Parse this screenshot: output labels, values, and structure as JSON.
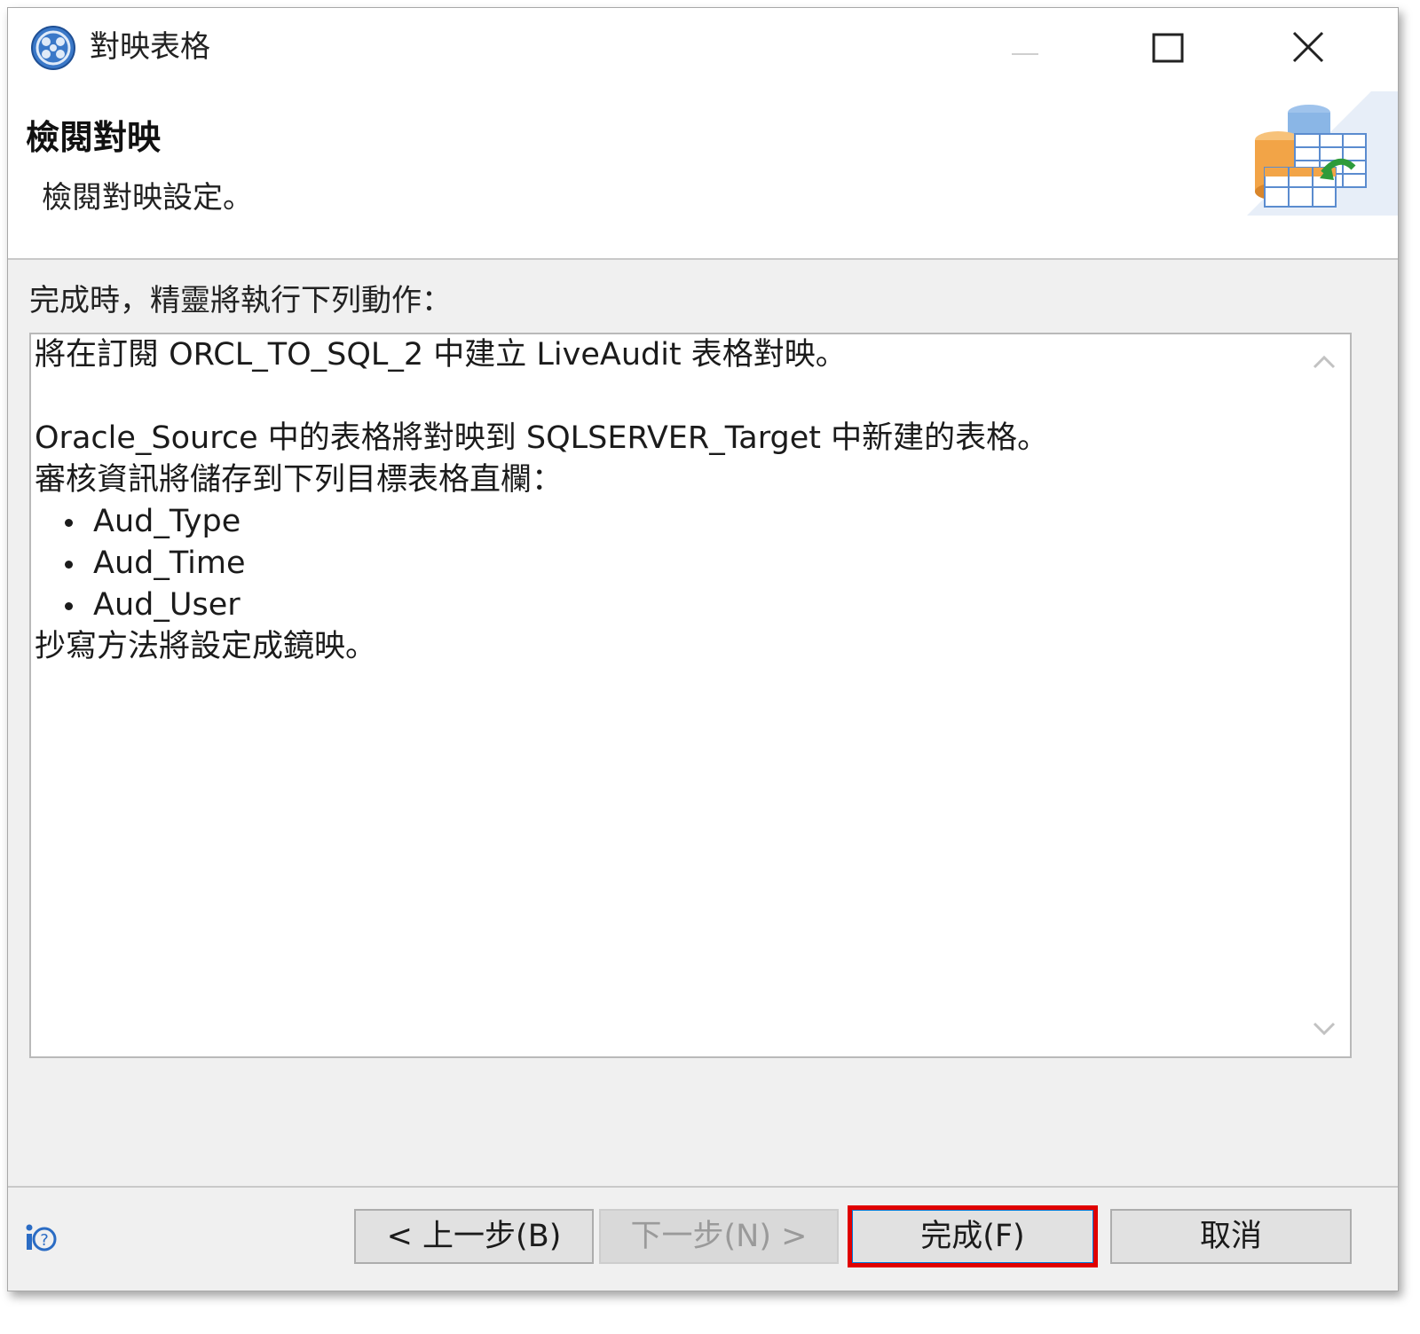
{
  "window": {
    "title": "對映表格",
    "icon": "app-globe-icon",
    "controls": [
      "minimize-icon",
      "maximize-icon",
      "close-icon"
    ]
  },
  "header": {
    "title": "檢閱對映",
    "description": "檢閱對映設定。",
    "banner_icon": "database-table-mapping-icon"
  },
  "main": {
    "actions_label": "完成時，精靈將執行下列動作：",
    "summary": {
      "line1": "將在訂閱 ORCL_TO_SQL_2 中建立 LiveAudit 表格對映。",
      "line2": "Oracle_Source 中的表格將對映到 SQLSERVER_Target 中新建的表格。",
      "line3": "審核資訊將儲存到下列目標表格直欄：",
      "columns": [
        "Aud_Type",
        "Aud_Time",
        "Aud_User"
      ],
      "line4": "抄寫方法將設定成鏡映。"
    }
  },
  "footer": {
    "help_icon": "help-icon",
    "back_label": "< 上一步(B)",
    "next_label": "下一步(N) >",
    "finish_label": "完成(F)",
    "cancel_label": "取消",
    "highlight_color": "#e00000"
  }
}
